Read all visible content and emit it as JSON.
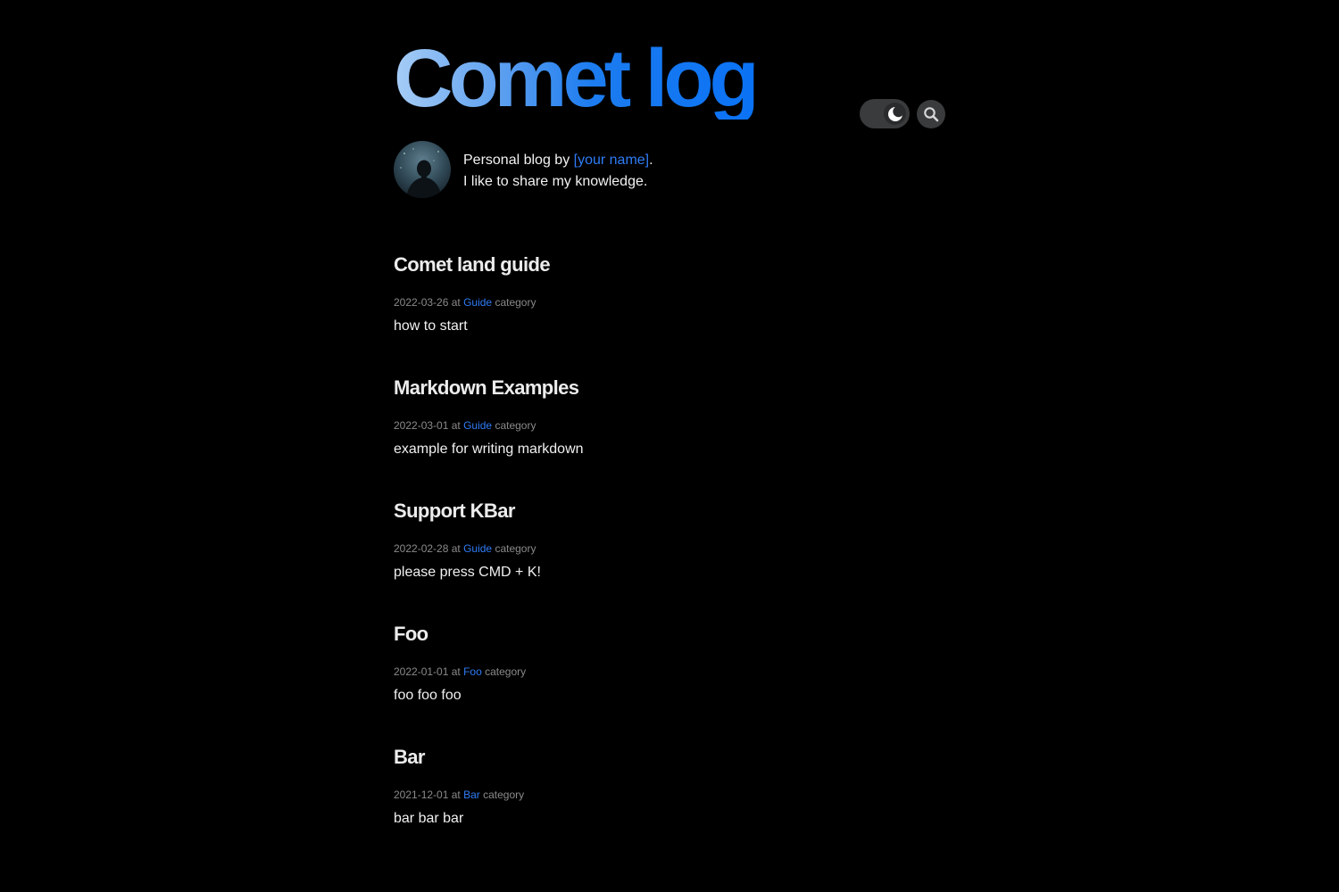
{
  "header": {
    "title": "Comet log"
  },
  "controls": {
    "theme_icon": "moon-icon",
    "search_icon": "search-icon"
  },
  "bio": {
    "line1_prefix": "Personal blog by ",
    "author_link": "[your name]",
    "line1_suffix": ".",
    "line2": "I like to share my knowledge."
  },
  "posts": [
    {
      "title": "Comet land guide",
      "date": "2022-03-26",
      "at": " at ",
      "category": "Guide",
      "category_suffix": " category",
      "description": "how to start"
    },
    {
      "title": "Markdown Examples",
      "date": "2022-03-01",
      "at": " at ",
      "category": "Guide",
      "category_suffix": " category",
      "description": "example for writing markdown"
    },
    {
      "title": "Support KBar",
      "date": "2022-02-28",
      "at": " at ",
      "category": "Guide",
      "category_suffix": " category",
      "description": "please press CMD + K!"
    },
    {
      "title": "Foo",
      "date": "2022-01-01",
      "at": " at ",
      "category": "Foo",
      "category_suffix": " category",
      "description": "foo foo foo"
    },
    {
      "title": "Bar",
      "date": "2021-12-01",
      "at": " at ",
      "category": "Bar",
      "category_suffix": " category",
      "description": "bar bar bar"
    }
  ],
  "colors": {
    "background": "#000000",
    "accent": "#2f7cf6",
    "meta": "#8a8a8a"
  }
}
